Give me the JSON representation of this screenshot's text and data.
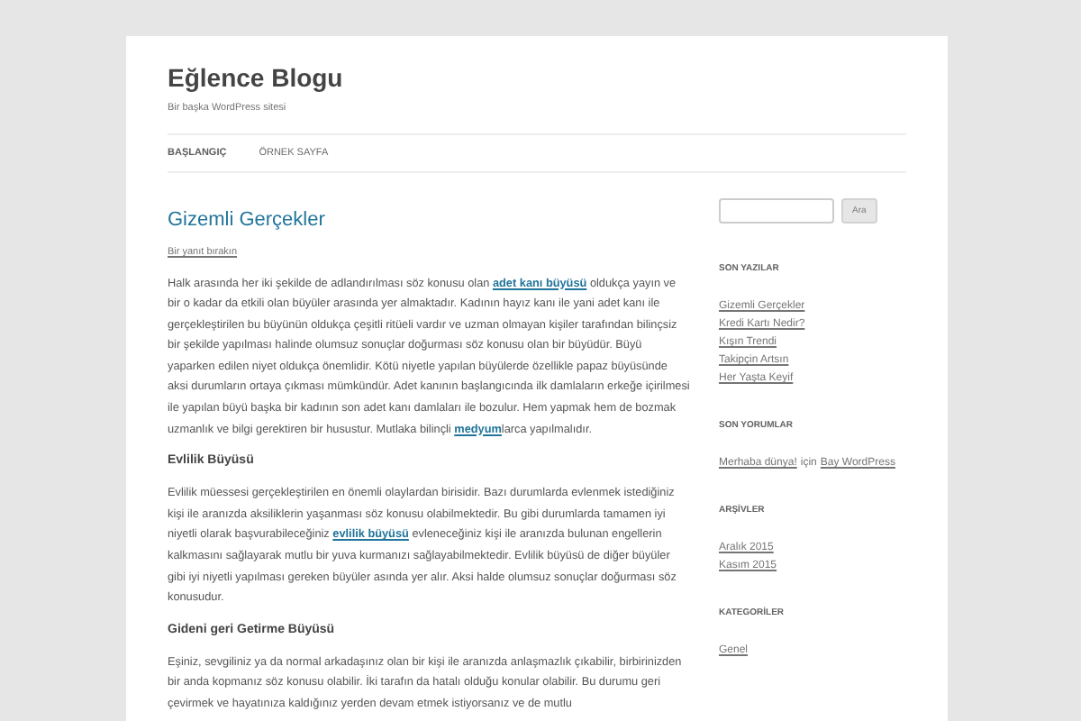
{
  "site": {
    "title": "Eğlence Blogu",
    "tagline": "Bir başka WordPress sitesi"
  },
  "nav": [
    {
      "label": "BAŞLANGIÇ",
      "selected": true
    },
    {
      "label": "ÖRNEK SAYFA",
      "selected": false
    }
  ],
  "post": {
    "title": "Gizemli Gerçekler",
    "reply_link": "Bir yanıt bırakın",
    "blocks": [
      {
        "kind": "paragraph",
        "parts": [
          {
            "kind": "text",
            "text": "Halk arasında her iki şekilde de adlandırılması söz konusu olan "
          },
          {
            "kind": "link",
            "text": "adet kanı büyüsü"
          },
          {
            "kind": "text",
            "text": " oldukça yayın ve bir o kadar da etkili olan büyüler arasında yer almaktadır. Kadının hayız kanı ile yani adet kanı ile gerçekleştirilen bu büyünün oldukça çeşitli ritüeli vardır ve uzman olmayan kişiler tarafından bilinçsiz bir şekilde yapılması halinde olumsuz sonuçlar doğurması söz konusu olan bir büyüdür. Büyü yaparken edilen niyet oldukça önemlidir. Kötü niyetle yapılan büyülerde özellikle papaz büyüsünde aksi durumların ortaya çıkması mümkündür. Adet kanının başlangıcında ilk damlaların erkeğe içirilmesi ile yapılan büyü başka bir kadının son adet kanı damlaları ile bozulur. Hem yapmak hem de bozmak uzmanlık ve bilgi gerektiren bir husustur. Mutlaka bilinçli "
          },
          {
            "kind": "link",
            "text": "medyum"
          },
          {
            "kind": "text",
            "text": "larca yapılmalıdır."
          }
        ]
      },
      {
        "kind": "heading",
        "text": "Evlilik Büyüsü"
      },
      {
        "kind": "paragraph",
        "parts": [
          {
            "kind": "text",
            "text": "Evlilik müessesi gerçekleştirilen en önemli olaylardan birisidir. Bazı durumlarda evlenmek istediğiniz kişi ile aranızda aksiliklerin yaşanması söz konusu olabilmektedir. Bu gibi durumlarda tamamen iyi niyetli olarak başvurabileceğiniz "
          },
          {
            "kind": "link",
            "text": "evlilik büyüsü"
          },
          {
            "kind": "text",
            "text": " evleneceğiniz kişi ile aranızda bulunan engellerin kalkmasını sağlayarak mutlu bir yuva kurmanızı sağlayabilmektedir. Evlilik büyüsü de diğer büyüler gibi iyi niyetli yapılması gereken büyüler asında yer alır. Aksi halde olumsuz sonuçlar doğurması söz konusudur."
          }
        ]
      },
      {
        "kind": "heading",
        "text": "Gideni geri Getirme Büyüsü"
      },
      {
        "kind": "paragraph",
        "parts": [
          {
            "kind": "text",
            "text": "Eşiniz, sevgiliniz ya da normal arkadaşınız olan bir kişi ile aranızda anlaşmazlık çıkabilir, birbirinizden bir anda kopmanız söz konusu olabilir. İki tarafın da hatalı olduğu konular olabilir. Bu durumu geri çevirmek ve hayatınıza kaldığınız yerden devam etmek istiyorsanız ve de mutlu"
          }
        ]
      }
    ]
  },
  "sidebar": {
    "search_button": "Ara",
    "widgets": [
      {
        "title": "SON YAZILAR",
        "kind": "links",
        "items": [
          "Gizemli Gerçekler",
          "Kredi Kartı Nedir?",
          "Kışın Trendi",
          "Takipçin Artsın",
          "Her Yaşta Keyif"
        ]
      },
      {
        "title": "SON YORUMLAR",
        "kind": "comment",
        "link": "Merhaba dünya!",
        "middle": "için",
        "author": "Bay WordPress"
      },
      {
        "title": "ARŞİVLER",
        "kind": "links",
        "items": [
          "Aralık 2015",
          "Kasım 2015"
        ]
      },
      {
        "title": "KATEGORİLER",
        "kind": "links",
        "items": [
          "Genel"
        ]
      }
    ]
  }
}
